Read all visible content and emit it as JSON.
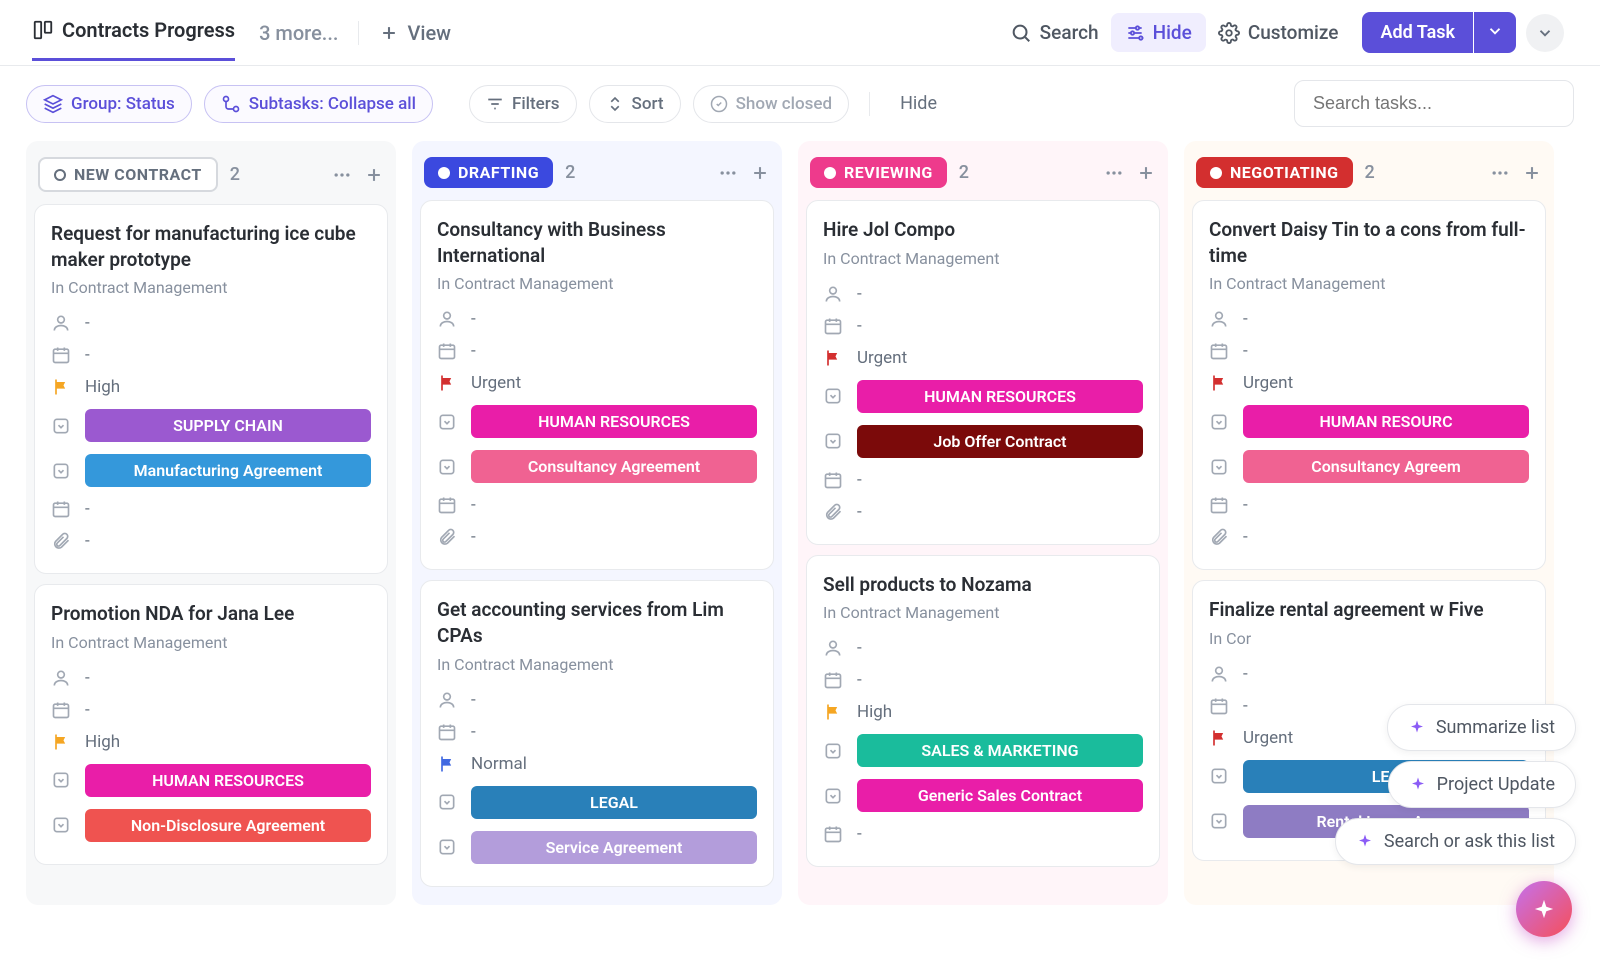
{
  "header": {
    "active_tab": "Contracts Progress",
    "more_tabs": "3 more...",
    "add_view": "View",
    "search": "Search",
    "hide": "Hide",
    "customize": "Customize",
    "add_task": "Add Task"
  },
  "toolbar": {
    "group": "Group: Status",
    "subtasks": "Subtasks: Collapse all",
    "filters": "Filters",
    "sort": "Sort",
    "show_closed": "Show closed",
    "hide": "Hide",
    "search_placeholder": "Search tasks..."
  },
  "columns": [
    {
      "id": "new",
      "label": "NEW CONTRACT",
      "count": "2",
      "cards": [
        {
          "title": "Request for manufacturing ice cube maker prototype",
          "sub": "In Contract Management",
          "assignee": "-",
          "date1": "-",
          "priority": "High",
          "priority_class": "flag-high",
          "tags": [
            {
              "text": "SUPPLY CHAIN",
              "cls": "tag-supply"
            },
            {
              "text": "Manufacturing Agreement",
              "cls": "tag-mfg"
            }
          ],
          "date2": "-",
          "attach": "-"
        },
        {
          "title": "Promotion NDA for Jana Lee",
          "sub": "In Contract Management",
          "assignee": "-",
          "date1": "-",
          "priority": "High",
          "priority_class": "flag-high",
          "tags": [
            {
              "text": "HUMAN RESOURCES",
              "cls": "tag-hr"
            },
            {
              "text": "Non-Disclosure Agreement",
              "cls": "tag-nda"
            }
          ]
        }
      ]
    },
    {
      "id": "draft",
      "label": "DRAFTING",
      "count": "2",
      "cards": [
        {
          "title": "Consultancy with Business International",
          "sub": "In Contract Management",
          "assignee": "-",
          "date1": "-",
          "priority": "Urgent",
          "priority_class": "flag-urgent",
          "tags": [
            {
              "text": "HUMAN RESOURCES",
              "cls": "tag-hr"
            },
            {
              "text": "Consultancy Agreement",
              "cls": "tag-consult"
            }
          ],
          "date2": "-",
          "attach": "-"
        },
        {
          "title": "Get accounting services from Lim CPAs",
          "sub": "In Contract Management",
          "assignee": "-",
          "date1": "-",
          "priority": "Normal",
          "priority_class": "flag-normal",
          "tags": [
            {
              "text": "LEGAL",
              "cls": "tag-legal"
            },
            {
              "text": "Service Agreement",
              "cls": "tag-service"
            }
          ]
        }
      ]
    },
    {
      "id": "review",
      "label": "REVIEWING",
      "count": "2",
      "cards": [
        {
          "title": "Hire Jol Compo",
          "sub": "In Contract Management",
          "assignee": "-",
          "date1": "-",
          "priority": "Urgent",
          "priority_class": "flag-urgent",
          "tags": [
            {
              "text": "HUMAN RESOURCES",
              "cls": "tag-hr"
            },
            {
              "text": "Job Offer Contract",
              "cls": "tag-job"
            }
          ],
          "date2": "-",
          "attach": "-"
        },
        {
          "title": "Sell products to Nozama",
          "sub": "In Contract Management",
          "assignee": "-",
          "date1": "-",
          "priority": "High",
          "priority_class": "flag-high",
          "tags": [
            {
              "text": "SALES & MARKETING",
              "cls": "tag-sales"
            },
            {
              "text": "Generic Sales Contract",
              "cls": "tag-generic"
            }
          ],
          "date2": "-"
        }
      ]
    },
    {
      "id": "neg",
      "label": "NEGOTIATING",
      "count": "2",
      "cards": [
        {
          "title": "Convert Daisy Tin to a cons from full-time",
          "sub": "In Contract Management",
          "assignee": "-",
          "date1": "-",
          "priority": "Urgent",
          "priority_class": "flag-urgent",
          "tags": [
            {
              "text": "HUMAN RESOURC",
              "cls": "tag-hr"
            },
            {
              "text": "Consultancy Agreem",
              "cls": "tag-consult"
            }
          ],
          "date2": "-",
          "attach": "-"
        },
        {
          "title": "Finalize rental agreement w Five",
          "sub": "In Cor",
          "assignee": "-",
          "date1": "-",
          "priority": "Urgent",
          "priority_class": "flag-urgent",
          "tags": [
            {
              "text": "LEG",
              "cls": "tag-legal"
            },
            {
              "text": "Rental Lease Agree",
              "cls": "tag-rental"
            }
          ]
        }
      ]
    }
  ],
  "ai": {
    "summarize": "Summarize list",
    "project": "Project Update",
    "search": "Search or ask this list"
  }
}
